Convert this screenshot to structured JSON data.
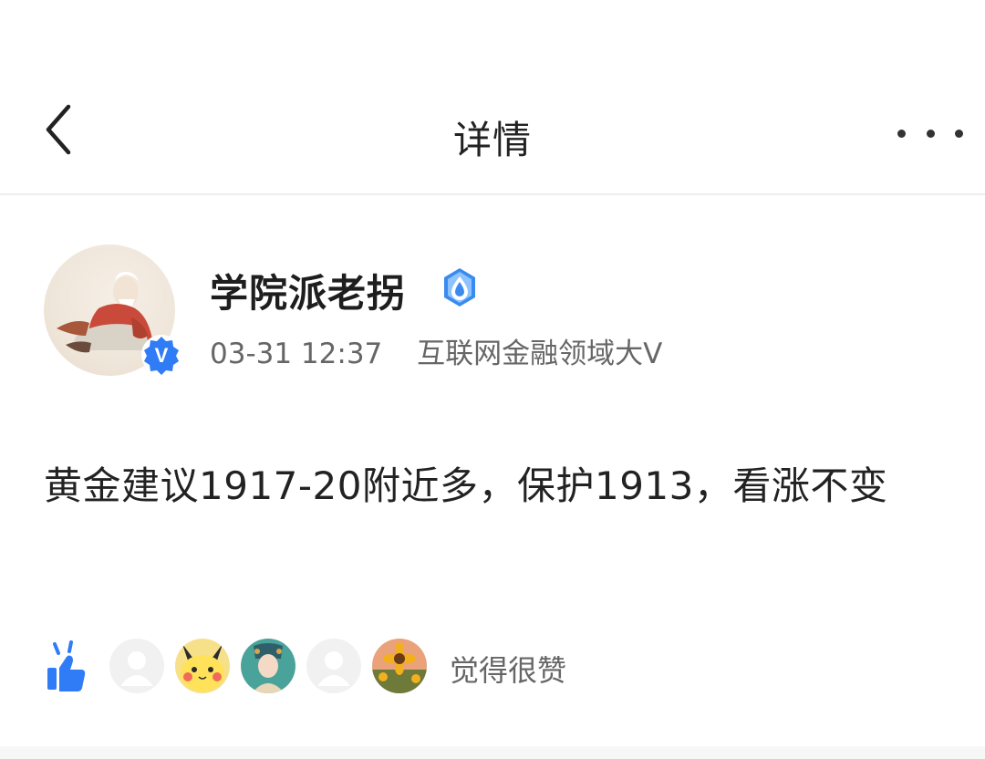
{
  "navbar": {
    "title": "详情",
    "back_icon": "chevron-left-icon",
    "more_icon": "more-horizontal-icon"
  },
  "author": {
    "name": "学院派老拐",
    "time": "03-31 12:37",
    "tag": "互联网金融领域大V",
    "verified_badge_letter": "V",
    "colors": {
      "badge_blue": "#2f7cf6",
      "name_badge_blue": "#3a8bf0"
    }
  },
  "post": {
    "text": "黄金建议1917-20附近多，保护1913，看涨不变"
  },
  "likes": {
    "icon": "thumbs-up-icon",
    "text": "觉得很赞",
    "avatars": [
      "default-avatar",
      "pikachu-avatar",
      "opera-avatar",
      "default-avatar",
      "sunflower-avatar"
    ],
    "colors": {
      "like_blue": "#2f7cf6"
    }
  }
}
